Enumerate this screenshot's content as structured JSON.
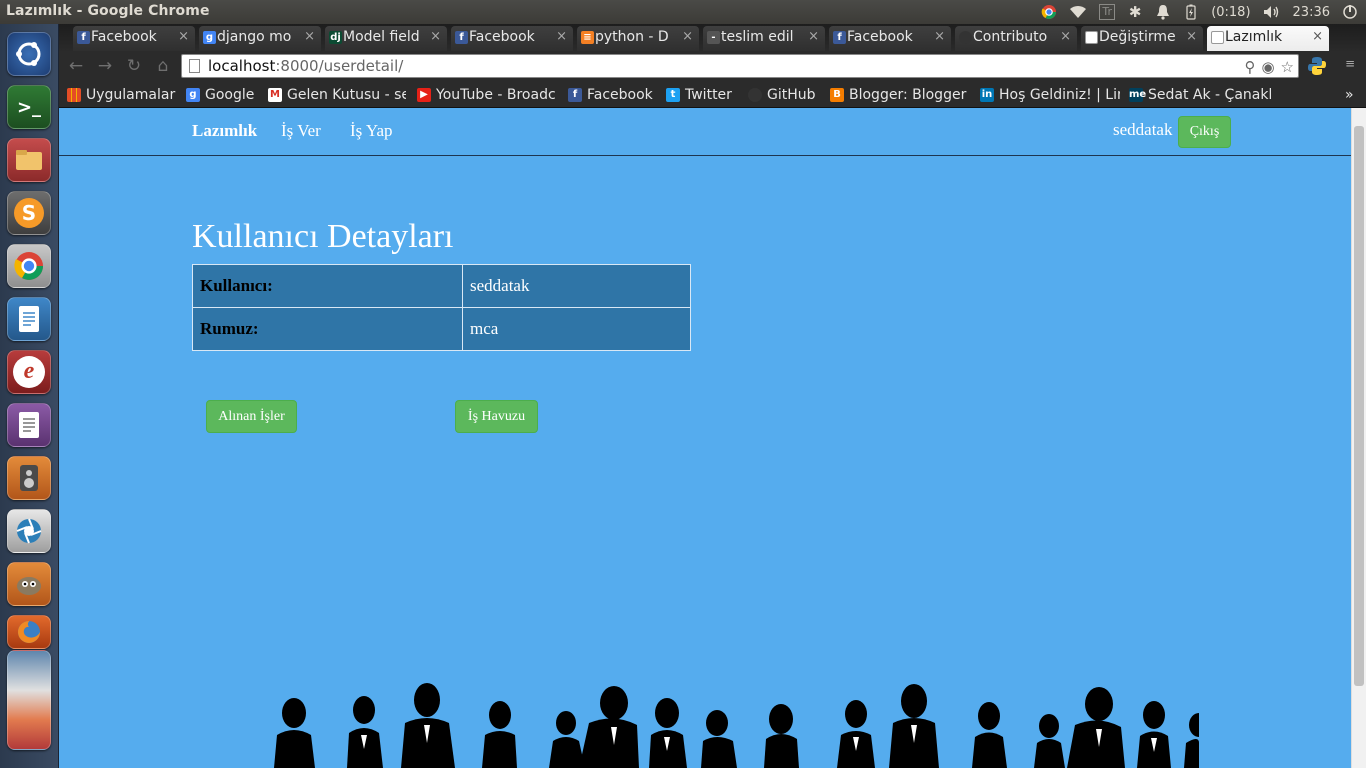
{
  "system": {
    "window_title": "Lazımlık - Google Chrome",
    "battery": "(0:18)",
    "clock": "23:36",
    "keyboard_layout": "Tr"
  },
  "launcher": {
    "items": [
      "ubuntu-dash",
      "terminal",
      "files",
      "sublime-text",
      "chrome",
      "text-editor",
      "ebook-reader",
      "document-viewer",
      "speaker-app",
      "shutter",
      "gimp",
      "firefox",
      "stacked-apps"
    ]
  },
  "browser": {
    "tabs": [
      {
        "label": "Facebook",
        "icon": "facebook-icon",
        "color": "#3b5998"
      },
      {
        "label": "django mo",
        "icon": "google-icon",
        "color": "#4285f4"
      },
      {
        "label": "Model field",
        "icon": "django-icon",
        "color": "#0c4b33"
      },
      {
        "label": "Facebook",
        "icon": "facebook-icon",
        "color": "#3b5998"
      },
      {
        "label": "python - D",
        "icon": "stackoverflow-icon",
        "color": "#f48024"
      },
      {
        "label": "teslim edil",
        "icon": "dash-icon",
        "color": "#555555"
      },
      {
        "label": "Facebook",
        "icon": "facebook-icon",
        "color": "#3b5998"
      },
      {
        "label": "Contributo",
        "icon": "github-icon",
        "color": "#333333"
      },
      {
        "label": "Değiştirme",
        "icon": "page-icon",
        "color": "#ffffff"
      },
      {
        "label": "Lazımlık",
        "icon": "page-icon",
        "color": "#ffffff"
      }
    ],
    "url_host": "localhost",
    "url_rest": ":8000/userdetail/",
    "bookmarks": [
      {
        "label": "Uygulamalar",
        "icon": "apps-grid-icon",
        "color": "#e44d26"
      },
      {
        "label": "Google",
        "icon": "google-icon",
        "color": "#4285f4"
      },
      {
        "label": "Gelen Kutusu - se",
        "icon": "gmail-icon",
        "color": "#d93025"
      },
      {
        "label": "YouTube - Broadc",
        "icon": "youtube-icon",
        "color": "#e62117"
      },
      {
        "label": "Facebook",
        "icon": "facebook-icon",
        "color": "#3b5998"
      },
      {
        "label": "Twitter",
        "icon": "twitter-icon",
        "color": "#1da1f2"
      },
      {
        "label": "GitHub",
        "icon": "github-icon",
        "color": "#333333"
      },
      {
        "label": "Blogger: Blogger",
        "icon": "blogger-icon",
        "color": "#f57d00"
      },
      {
        "label": "Hoş Geldiniz! | Lin",
        "icon": "linkedin-icon",
        "color": "#0077b5"
      },
      {
        "label": "Sedat Ak - Çanakk",
        "icon": "aboutme-icon",
        "color": "#00405d"
      }
    ],
    "more_bookmarks": "»"
  },
  "page": {
    "brand": "Lazımlık",
    "nav": [
      "İş Ver",
      "İş Yap"
    ],
    "username": "seddatak",
    "logout_label": "Çıkış",
    "title": "Kullanıcı Detayları",
    "rows": [
      {
        "key": "Kullanıcı:",
        "value": "seddatak"
      },
      {
        "key": "Rumuz:",
        "value": "mca"
      }
    ],
    "btn_taken_jobs": "Alınan İşler",
    "btn_job_pool": "İş Havuzu",
    "accent_color": "#55acee",
    "button_color": "#5cb85c"
  }
}
